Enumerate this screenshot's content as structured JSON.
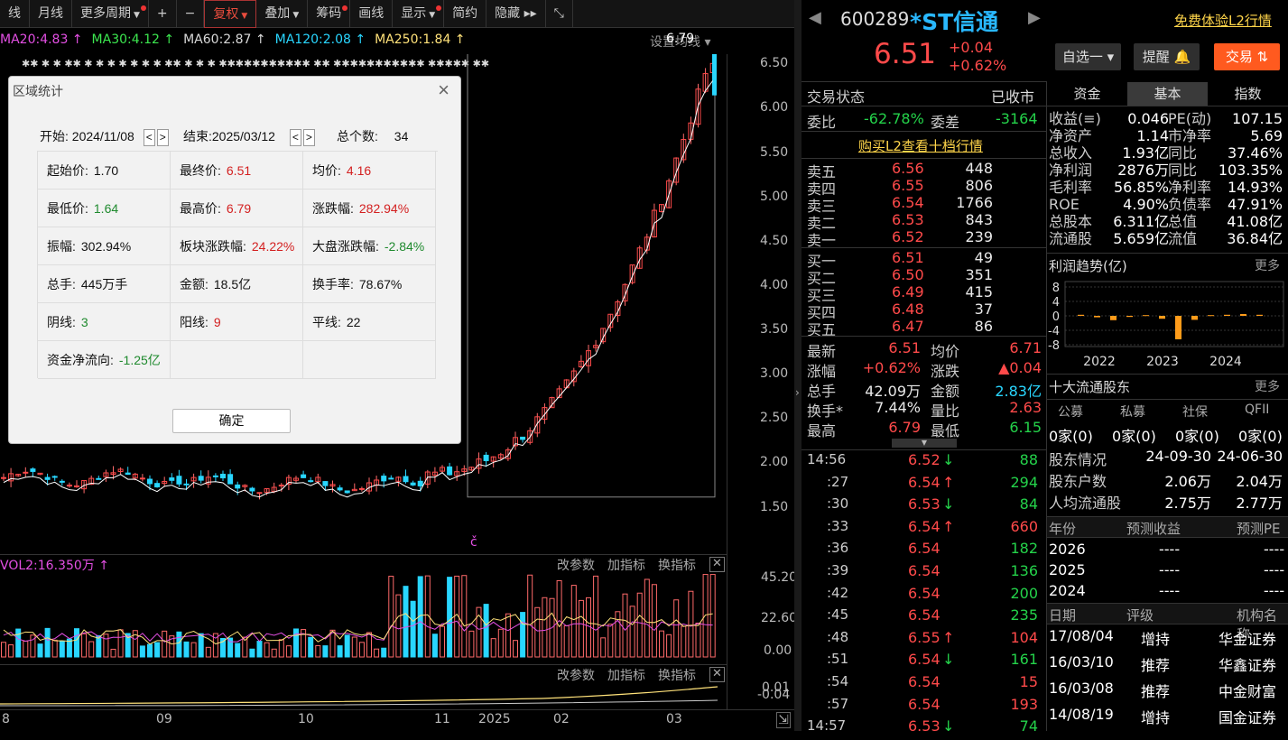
{
  "toolbar": {
    "items": [
      {
        "label": "线",
        "dot": false,
        "caret": false
      },
      {
        "label": "月线",
        "dot": false,
        "caret": false
      },
      {
        "label": "更多周期",
        "dot": true,
        "caret": true
      },
      {
        "label": "+",
        "dot": false,
        "caret": false
      },
      {
        "label": "−",
        "dot": false,
        "caret": false
      },
      {
        "label": "复权",
        "dot": false,
        "caret": true,
        "hi": true
      },
      {
        "label": "叠加",
        "dot": false,
        "caret": true
      },
      {
        "label": "筹码",
        "dot": true,
        "caret": false
      },
      {
        "label": "画线",
        "dot": false,
        "caret": false
      },
      {
        "label": "显示",
        "dot": true,
        "caret": true
      },
      {
        "label": "简约",
        "dot": false,
        "caret": false
      },
      {
        "label": "隐藏 ▸▸",
        "dot": false,
        "caret": false
      },
      {
        "label": "⤡",
        "dot": false,
        "caret": false
      }
    ]
  },
  "ma": [
    {
      "t": "MA20:4.83 ↑",
      "color": "#e34fe3"
    },
    {
      "t": "MA30:4.12 ↑",
      "color": "#3ce64f"
    },
    {
      "t": "MA60:2.87 ↑",
      "color": "#d8d8d8"
    },
    {
      "t": "MA120:2.08 ↑",
      "color": "#29d6ff"
    },
    {
      "t": "MA250:1.84 ↑",
      "color": "#ffe27a"
    }
  ],
  "ma_settings": "设置均线 ▾",
  "star_rows": "✱✱        ✱  ✱ ✱✱ ✱  ✱        ✱       ✱   ✱    ✱     ✱     ✱✱ ✱  ✱ ✱ ✱✱✱✱✱✱✱✱✱✱✱ ✱✱ ✱✱✱✱✱✱✱✱✱✱✱ ✱✱✱✱✱  ✱✱",
  "peak_label": "6.79",
  "price_axis": [
    "6.50",
    "6.00",
    "5.50",
    "5.00",
    "4.50",
    "4.00",
    "3.50",
    "3.00",
    "2.50",
    "2.00",
    "1.50"
  ],
  "vol": {
    "label": "VOL2:16.350万 ↑",
    "btns": [
      "改参数",
      "加指标",
      "换指标"
    ],
    "axis": [
      "45.20",
      "22.60",
      "0.00"
    ]
  },
  "sub2": {
    "btns": [
      "改参数",
      "加指标",
      "换指标"
    ],
    "axis": [
      "0.01",
      "-0.04"
    ]
  },
  "xaxis": [
    "8",
    "09",
    "10",
    "11",
    "2025",
    "02",
    "03"
  ],
  "chart_data": {
    "type": "candlestick",
    "peak": 6.79,
    "ylim": [
      1.2,
      6.9
    ],
    "ma": {
      "MA20": 4.83,
      "MA30": 4.12,
      "MA60": 2.87,
      "MA120": 2.08,
      "MA250": 1.84
    }
  },
  "dialog": {
    "title": "区域统计",
    "start": "开始: 2024/11/08",
    "end": "结束:2025/03/12",
    "count_label": "总个数:",
    "count": "34",
    "cells": [
      [
        {
          "l": "起始价:",
          "v": "1.70",
          "c": ""
        },
        {
          "l": "最终价:",
          "v": "6.51",
          "c": "red"
        },
        {
          "l": "均价:",
          "v": "4.16",
          "c": "red"
        }
      ],
      [
        {
          "l": "最低价:",
          "v": "1.64",
          "c": "green"
        },
        {
          "l": "最高价:",
          "v": "6.79",
          "c": "red"
        },
        {
          "l": "涨跌幅:",
          "v": "282.94%",
          "c": "red"
        }
      ],
      [
        {
          "l": "振幅:",
          "v": "302.94%",
          "c": ""
        },
        {
          "l": "板块涨跌幅:",
          "v": "24.22%",
          "c": "red"
        },
        {
          "l": "大盘涨跌幅:",
          "v": "-2.84%",
          "c": "green"
        }
      ],
      [
        {
          "l": "总手:",
          "v": "445万手",
          "c": ""
        },
        {
          "l": "金额:",
          "v": "18.5亿",
          "c": ""
        },
        {
          "l": "换手率:",
          "v": "78.67%",
          "c": ""
        }
      ],
      [
        {
          "l": "阴线:",
          "v": "3",
          "c": "green"
        },
        {
          "l": "阳线:",
          "v": "9",
          "c": "red"
        },
        {
          "l": "平线:",
          "v": "22",
          "c": ""
        }
      ],
      [
        {
          "l": "资金净流向:",
          "v": "-1.25亿",
          "c": "green"
        },
        {
          "l": "",
          "v": "",
          "c": ""
        },
        {
          "l": "",
          "v": "",
          "c": ""
        }
      ]
    ],
    "ok": "确定"
  },
  "stock": {
    "code": "600289",
    "name": "*ST信通",
    "l2": "免费体验L2行情",
    "price": "6.51",
    "chg": "+0.04",
    "pct": "+0.62%",
    "zixuan": "自选一 ▾",
    "tixing": "提醒 🔔",
    "jiaoyi": "交易 ⇅"
  },
  "status": {
    "label": "交易状态",
    "value": "已收市",
    "weibi_l": "委比",
    "weibi": "-62.78%",
    "weicha_l": "委差",
    "weicha": "-3164",
    "buyl2": "购买L2查看十档行情"
  },
  "asks": [
    [
      "卖五",
      "6.56",
      "448"
    ],
    [
      "卖四",
      "6.55",
      "806"
    ],
    [
      "卖三",
      "6.54",
      "1766"
    ],
    [
      "卖二",
      "6.53",
      "843"
    ],
    [
      "卖一",
      "6.52",
      "239"
    ]
  ],
  "bids": [
    [
      "买一",
      "6.51",
      "49"
    ],
    [
      "买二",
      "6.50",
      "351"
    ],
    [
      "买三",
      "6.49",
      "415"
    ],
    [
      "买四",
      "6.48",
      "37"
    ],
    [
      "买五",
      "6.47",
      "86"
    ]
  ],
  "quote": [
    [
      "最新",
      "6.51",
      "r",
      "均价",
      "6.71",
      "r"
    ],
    [
      "涨幅",
      "+0.62%",
      "r",
      "涨跌",
      "▲0.04",
      "r"
    ],
    [
      "总手",
      "42.09万",
      "w",
      "金额",
      "2.83亿",
      "c"
    ],
    [
      "换手*",
      "7.44%",
      "w",
      "量比",
      "2.63",
      "r"
    ],
    [
      "最高",
      "6.79",
      "r",
      "最低",
      "6.15",
      "g"
    ]
  ],
  "ticks": [
    [
      "14:56",
      "6.52",
      "↓",
      "88",
      "g"
    ],
    [
      ":27",
      "6.54",
      "↑",
      "294",
      "g"
    ],
    [
      ":30",
      "6.53",
      "↓",
      "84",
      "g"
    ],
    [
      ":33",
      "6.54",
      "↑",
      "660",
      "r"
    ],
    [
      ":36",
      "6.54",
      "",
      "182",
      "g"
    ],
    [
      ":39",
      "6.54",
      "",
      "136",
      "g"
    ],
    [
      ":42",
      "6.54",
      "",
      "200",
      "g"
    ],
    [
      ":45",
      "6.54",
      "",
      "235",
      "g"
    ],
    [
      ":48",
      "6.55",
      "↑",
      "104",
      "r"
    ],
    [
      ":51",
      "6.54",
      "↓",
      "161",
      "g"
    ],
    [
      ":54",
      "6.54",
      "",
      "15",
      "r"
    ],
    [
      ":57",
      "6.54",
      "",
      "193",
      "r"
    ],
    [
      "14:57",
      "6.53",
      "↓",
      "74",
      "g"
    ]
  ],
  "tabs": [
    "资金",
    "基本",
    "指数"
  ],
  "fund": [
    [
      "收益(≡)",
      "0.046",
      "PE(动)",
      "107.15"
    ],
    [
      "净资产",
      "1.14",
      "市净率",
      "5.69"
    ],
    [
      "总收入",
      "1.93亿",
      "同比",
      "37.46%"
    ],
    [
      "净利润",
      "2876万",
      "同比",
      "103.35%"
    ],
    [
      "毛利率",
      "56.85%",
      "净利率",
      "14.93%"
    ],
    [
      "ROE",
      "4.90%",
      "负债率",
      "47.91%"
    ],
    [
      "总股本",
      "6.311亿",
      "总值",
      "41.08亿"
    ],
    [
      "流通股",
      "5.659亿",
      "流值",
      "36.84亿"
    ]
  ],
  "profit": {
    "title": "利润趋势(亿)",
    "more": "更多",
    "yaxis": [
      "8",
      "4",
      "0",
      "-4",
      "-8"
    ],
    "years": [
      "2022",
      "2023",
      "2024"
    ],
    "bars": [
      0.3,
      -0.4,
      -1.2,
      -0.3,
      0.2,
      -0.8,
      -6.5,
      -1.1,
      0.2,
      0.3,
      0.5,
      0.3
    ]
  },
  "holders": {
    "title": "十大流通股东",
    "more": "更多",
    "cats": [
      "公募",
      "私募",
      "社保",
      "QFII"
    ],
    "vals": [
      "0家(0)",
      "0家(0)",
      "0家(0)",
      "0家(0)"
    ],
    "rows": [
      [
        "股东情况",
        "24-09-30",
        "24-06-30"
      ],
      [
        "股东户数",
        "2.06万",
        "2.04万"
      ],
      [
        "人均流通股",
        "2.75万",
        "2.77万"
      ]
    ]
  },
  "forecast": {
    "h": [
      "年份",
      "预测收益",
      "预测PE"
    ],
    "rows": [
      [
        "2026",
        "----",
        "----"
      ],
      [
        "2025",
        "----",
        "----"
      ],
      [
        "2024",
        "----",
        "----"
      ]
    ]
  },
  "ratings": {
    "h": [
      "日期",
      "评级",
      "机构名称"
    ],
    "rows": [
      [
        "17/08/04",
        "增持",
        "华金证券"
      ],
      [
        "16/03/10",
        "推荐",
        "华鑫证券"
      ],
      [
        "16/03/08",
        "推荐",
        "中金财富"
      ],
      [
        "14/08/19",
        "增持",
        "国金证券"
      ]
    ]
  }
}
